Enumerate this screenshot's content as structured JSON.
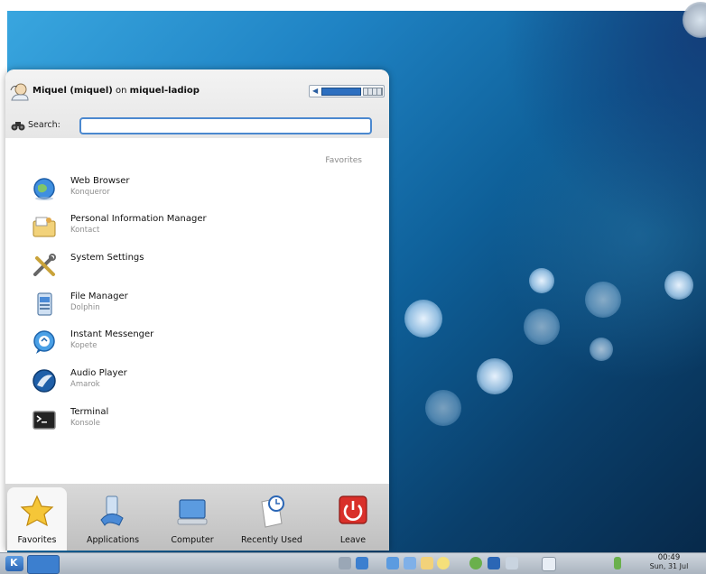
{
  "header": {
    "user_name": "Miquel (miquel)",
    "connector": "on",
    "host": "miquel-ladiop"
  },
  "search": {
    "label": "Search:",
    "value": "",
    "placeholder": ""
  },
  "favorites_heading": "Favorites",
  "favorites": [
    {
      "name": "Web Browser",
      "app": "Konqueror",
      "icon": "globe-icon"
    },
    {
      "name": "Personal Information Manager",
      "app": "Kontact",
      "icon": "contact-folder-icon"
    },
    {
      "name": "System Settings",
      "app": "",
      "icon": "tools-icon"
    },
    {
      "name": "File Manager",
      "app": "Dolphin",
      "icon": "file-manager-icon"
    },
    {
      "name": "Instant Messenger",
      "app": "Kopete",
      "icon": "chat-icon"
    },
    {
      "name": "Audio Player",
      "app": "Amarok",
      "icon": "amarok-icon"
    },
    {
      "name": "Terminal",
      "app": "Konsole",
      "icon": "terminal-icon"
    }
  ],
  "tabs": [
    {
      "label": "Favorites",
      "icon": "star-icon",
      "active": true
    },
    {
      "label": "Applications",
      "icon": "applications-icon",
      "active": false
    },
    {
      "label": "Computer",
      "icon": "computer-icon",
      "active": false
    },
    {
      "label": "Recently Used",
      "icon": "clock-document-icon",
      "active": false
    },
    {
      "label": "Leave",
      "icon": "power-icon",
      "active": false
    }
  ],
  "taskbar": {
    "clock_time": "00:49",
    "clock_date": "Sun, 31 Jul"
  },
  "colors": {
    "accent": "#4b88cf",
    "desktop_dark": "#0a3f6b",
    "leave_red": "#d9302a"
  }
}
